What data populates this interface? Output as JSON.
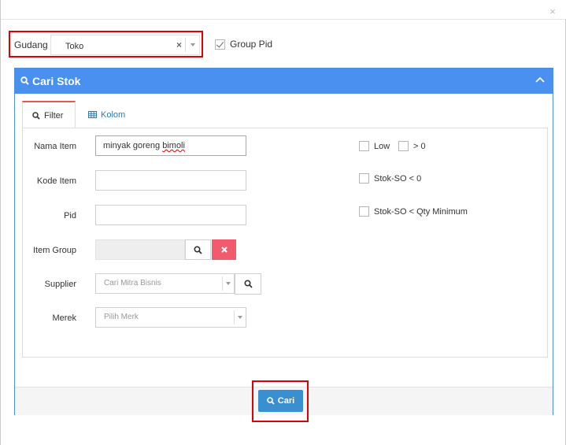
{
  "window": {
    "close_symbol": "×"
  },
  "gudang": {
    "label": "Gudang",
    "value": "Toko",
    "clear_symbol": "×"
  },
  "group_pid": {
    "label": "Group Pid",
    "checked": true
  },
  "panel": {
    "title": "Cari Stok"
  },
  "tabs": [
    {
      "label": "Filter",
      "active": true
    },
    {
      "label": "Kolom",
      "active": false
    }
  ],
  "form": {
    "nama_item": {
      "label": "Nama Item",
      "value_prefix": "minyak goreng ",
      "value_misspelled": "bimoli"
    },
    "kode_item": {
      "label": "Kode Item",
      "value": ""
    },
    "pid": {
      "label": "Pid",
      "value": ""
    },
    "item_group": {
      "label": "Item Group",
      "value": ""
    },
    "supplier": {
      "label": "Supplier",
      "placeholder": "Cari Mitra Bisnis"
    },
    "merek": {
      "label": "Merek",
      "placeholder": "Pilih Merk"
    }
  },
  "checkboxes": {
    "low": {
      "label": "Low",
      "checked": false
    },
    "gt0": {
      "label": "> 0",
      "checked": false
    },
    "stok_so_lt0": {
      "label": "Stok-SO < 0",
      "checked": false
    },
    "stok_so_lt_qty": {
      "label": "Stok-SO < Qty Minimum",
      "checked": false
    }
  },
  "footer": {
    "cari_label": "Cari"
  },
  "colors": {
    "header_blue": "#4a90f0",
    "button_blue": "#3a8fd0",
    "clear_red": "#f05c6e",
    "highlight_red": "#e00000"
  }
}
